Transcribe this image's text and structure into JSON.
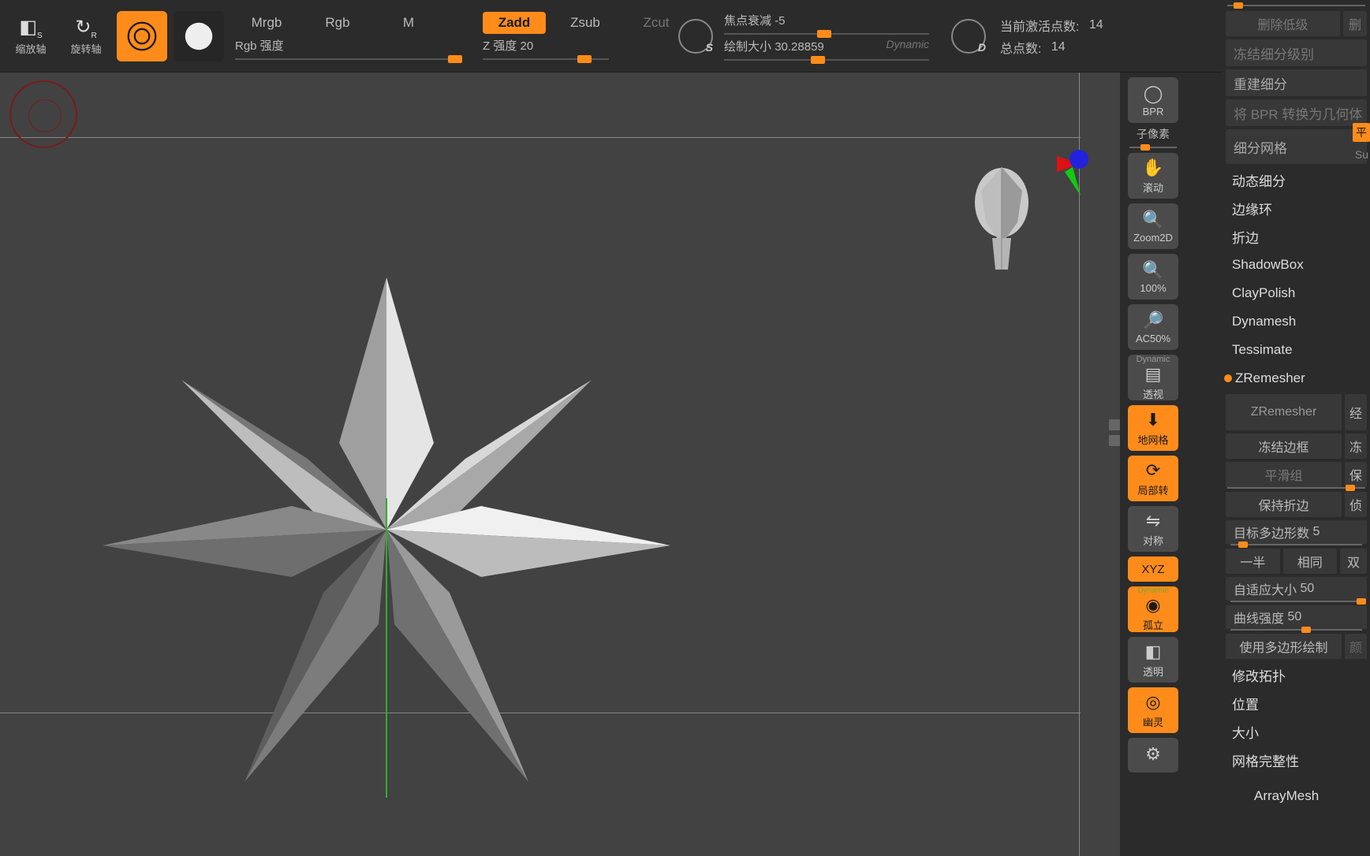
{
  "top": {
    "scale_axis": "缩放轴",
    "rotate_axis": "旋转轴",
    "mrgb": "Mrgb",
    "rgb": "Rgb",
    "m": "M",
    "rgb_intensity_label": "Rgb 强度",
    "zadd": "Zadd",
    "zsub": "Zsub",
    "zcut": "Zcut",
    "z_intensity_label": "Z 强度",
    "z_intensity_value": "20",
    "focal_shift_label": "焦点衰减",
    "focal_shift_value": "-5",
    "draw_size_label": "绘制大小",
    "draw_size_value": "30.28859",
    "dynamic": "Dynamic",
    "focal_s": "S",
    "focal_d": "D",
    "active_points_label": "当前激活点数:",
    "active_points_value": "14",
    "total_points_label": "总点数:",
    "total_points_value": "14"
  },
  "right_tools": {
    "bpr": "BPR",
    "subpixel": "子像素",
    "scroll": "滚动",
    "zoom2d": "Zoom2D",
    "pct100": "100%",
    "ac50": "AC50%",
    "dynamic": "Dynamic",
    "persp": "透视",
    "floor": "地网格",
    "local": "局部转",
    "symmetry": "对称",
    "xyz": "XYZ",
    "solo_dynamic": "Dynamic",
    "solo": "孤立",
    "transp": "透明",
    "ghost": "幽灵"
  },
  "panel": {
    "del_lower": "删除低级",
    "del": "删",
    "freeze_subdiv": "冻结细分级别",
    "reconstruct": "重建细分",
    "bpr_to_geo": "将 BPR 转换为几何体",
    "subdiv_mesh": "细分网格",
    "flat_tag": "平",
    "su_tag": "Su",
    "dynamic_subdiv": "动态细分",
    "edge_loop": "边缘环",
    "crease": "折边",
    "shadowbox": "ShadowBox",
    "claypolish": "ClayPolish",
    "dynamesh": "Dynamesh",
    "tessimate": "Tessimate",
    "zremesher_header": "ZRemesher",
    "zremesher_btn": "ZRemesher",
    "suffix_jing": "经",
    "freeze_border": "冻结边框",
    "freeze_suffix": "冻",
    "smooth_groups": "平滑组",
    "smooth_suffix": "保",
    "keep_crease": "保持折边",
    "keep_crease_suffix": "侦",
    "target_poly_label": "目标多边形数",
    "target_poly_value": "5",
    "half": "一半",
    "same": "相同",
    "double": "双",
    "adaptive_label": "自适应大小",
    "adaptive_value": "50",
    "curve_label": "曲线强度",
    "curve_value": "50",
    "use_polypaint": "使用多边形绘制",
    "use_suffix": "颜",
    "modify_topo": "修改拓扑",
    "position": "位置",
    "size": "大小",
    "mesh_integrity": "网格完整性",
    "arraymesh": "ArrayMesh"
  }
}
